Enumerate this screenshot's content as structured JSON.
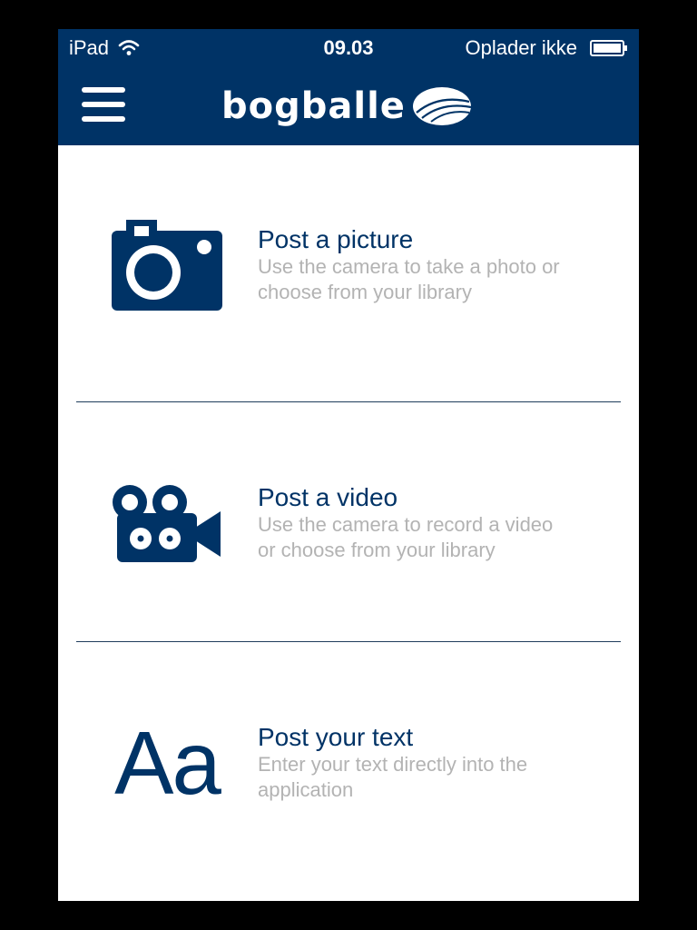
{
  "status_bar": {
    "device": "iPad",
    "time": "09.03",
    "charging_status": "Oplader ikke"
  },
  "nav": {
    "logo_text": "bogballe"
  },
  "options": [
    {
      "title": "Post a picture",
      "description_line1": "Use the camera to take a photo or",
      "description_line2": "choose from your library",
      "icon": "camera-icon"
    },
    {
      "title": "Post a video",
      "description_line1": "Use the camera to record a video",
      "description_line2": "or choose from your library",
      "icon": "video-camera-icon"
    },
    {
      "title": "Post your text",
      "description_line1": "Enter your text directly into the",
      "description_line2": "application",
      "icon": "text-icon",
      "glyph": "Aa"
    }
  ],
  "colors": {
    "brand": "#003366",
    "description": "#b3b3b3",
    "background": "#ffffff"
  }
}
